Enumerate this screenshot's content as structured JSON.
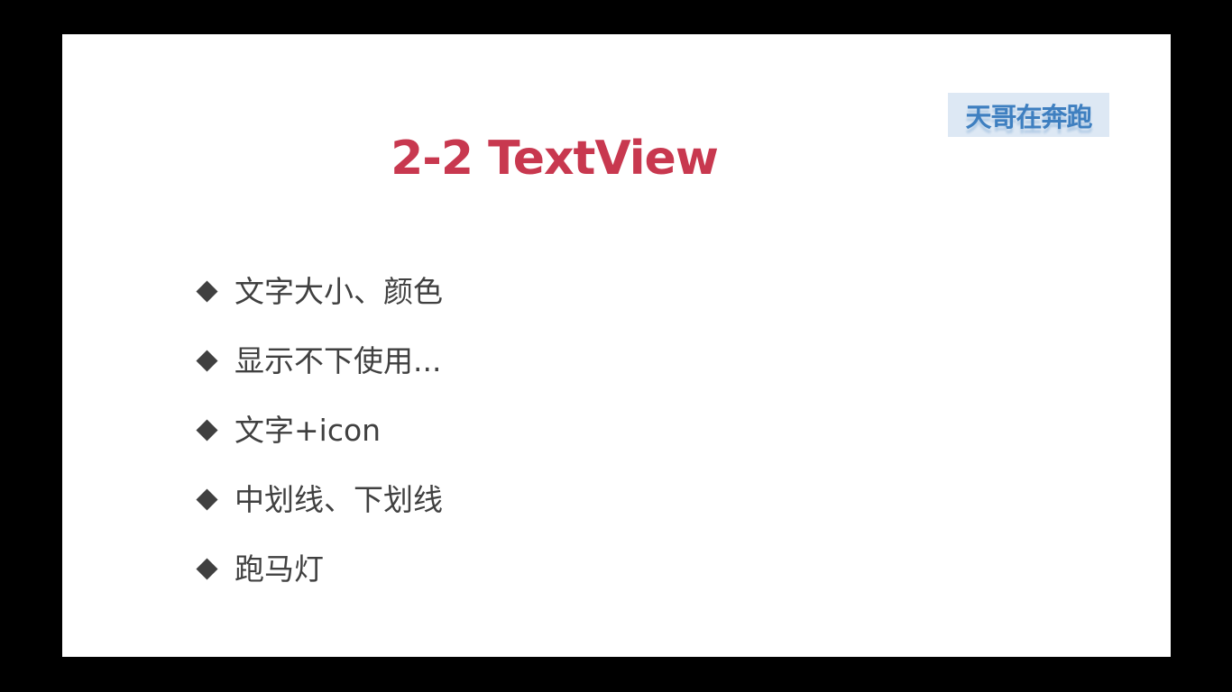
{
  "slide": {
    "title": "2-2 TextView",
    "logo_text": "天哥在奔跑",
    "bullets": [
      "文字大小、颜色",
      "显示不下使用...",
      "文字+icon",
      "中划线、下划线",
      "跑马灯"
    ]
  },
  "colors": {
    "background": "#000000",
    "slide": "#ffffff",
    "title": "#c8384f",
    "logo_text": "#3e7fc0",
    "logo_background": "#dde8f4",
    "bullet_text": "#404040"
  },
  "icons": {
    "bullet": "diamond-bullet-icon"
  }
}
